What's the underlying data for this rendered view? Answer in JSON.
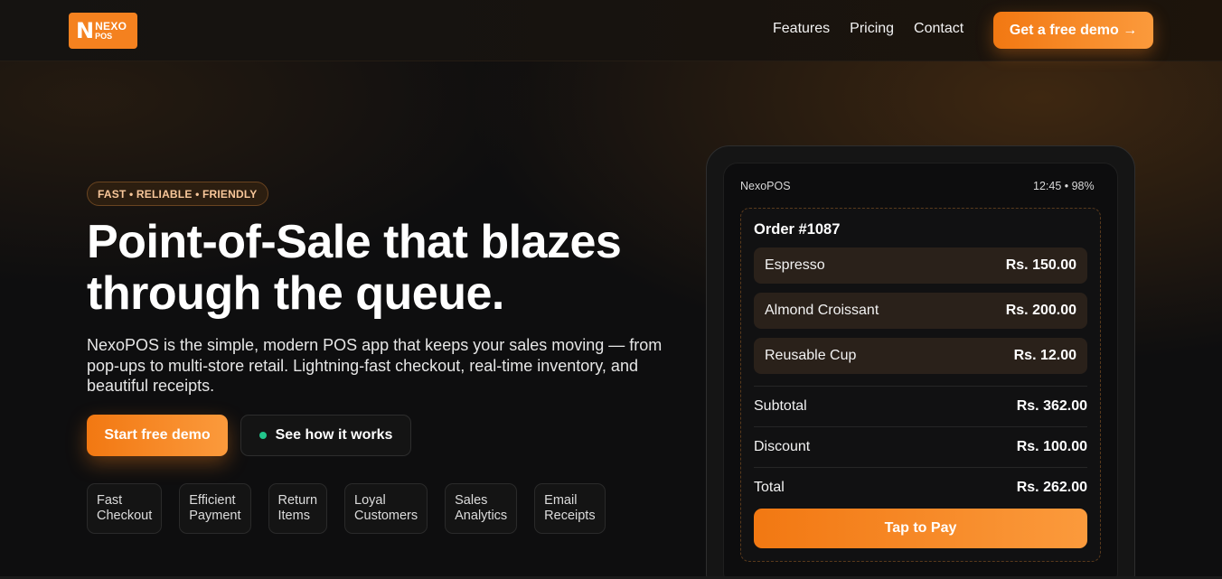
{
  "header": {
    "logo": {
      "mark": "N",
      "line1": "NEXO",
      "line2": "POS"
    },
    "nav": [
      "Features",
      "Pricing",
      "Contact"
    ],
    "cta": "Get a free demo →"
  },
  "hero": {
    "badge": "FAST • RELIABLE • FRIENDLY",
    "headline_line1": "Point-of-Sale that blazes",
    "headline_line2": "through the queue.",
    "subtext": "NexoPOS is the simple, modern POS app that keeps your sales moving — from pop-ups to multi-store retail. Lightning-fast checkout, real-time inventory, and beautiful receipts.",
    "primary_button": "Start free demo",
    "secondary_button": "See how it works",
    "features": [
      {
        "line1": "Fast",
        "line2": "Checkout"
      },
      {
        "line1": "Efficient",
        "line2": "Payment"
      },
      {
        "line1": "Return",
        "line2": "Items"
      },
      {
        "line1": "Loyal",
        "line2": "Customers"
      },
      {
        "line1": "Sales",
        "line2": "Analytics"
      },
      {
        "line1": "Email",
        "line2": "Receipts"
      }
    ]
  },
  "device": {
    "app_name": "NexoPOS",
    "status": "12:45 • 98%",
    "order_title": "Order #1087",
    "items": [
      {
        "name": "Espresso",
        "price": "Rs. 150.00"
      },
      {
        "name": "Almond Croissant",
        "price": "Rs. 200.00"
      },
      {
        "name": "Reusable Cup",
        "price": "Rs. 12.00"
      }
    ],
    "subtotal_label": "Subtotal",
    "subtotal": "Rs. 362.00",
    "discount_label": "Discount",
    "discount": "Rs. 100.00",
    "total_label": "Total",
    "total": "Rs. 262.00",
    "pay_button": "Tap to Pay"
  },
  "colors": {
    "accent": "#f4811f",
    "accent_light": "#fb9a3c",
    "status_dot": "#22c58b",
    "background": "#0d0d0e"
  }
}
